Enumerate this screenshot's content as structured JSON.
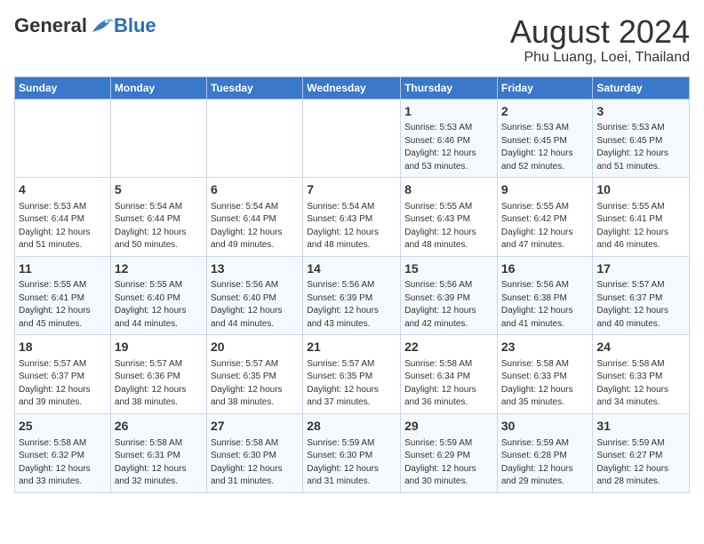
{
  "header": {
    "logo_general": "General",
    "logo_blue": "Blue",
    "title": "August 2024",
    "subtitle": "Phu Luang, Loei, Thailand"
  },
  "days_of_week": [
    "Sunday",
    "Monday",
    "Tuesday",
    "Wednesday",
    "Thursday",
    "Friday",
    "Saturday"
  ],
  "weeks": [
    [
      {
        "day": "",
        "info": ""
      },
      {
        "day": "",
        "info": ""
      },
      {
        "day": "",
        "info": ""
      },
      {
        "day": "",
        "info": ""
      },
      {
        "day": "1",
        "info": "Sunrise: 5:53 AM\nSunset: 6:46 PM\nDaylight: 12 hours\nand 53 minutes."
      },
      {
        "day": "2",
        "info": "Sunrise: 5:53 AM\nSunset: 6:45 PM\nDaylight: 12 hours\nand 52 minutes."
      },
      {
        "day": "3",
        "info": "Sunrise: 5:53 AM\nSunset: 6:45 PM\nDaylight: 12 hours\nand 51 minutes."
      }
    ],
    [
      {
        "day": "4",
        "info": "Sunrise: 5:53 AM\nSunset: 6:44 PM\nDaylight: 12 hours\nand 51 minutes."
      },
      {
        "day": "5",
        "info": "Sunrise: 5:54 AM\nSunset: 6:44 PM\nDaylight: 12 hours\nand 50 minutes."
      },
      {
        "day": "6",
        "info": "Sunrise: 5:54 AM\nSunset: 6:44 PM\nDaylight: 12 hours\nand 49 minutes."
      },
      {
        "day": "7",
        "info": "Sunrise: 5:54 AM\nSunset: 6:43 PM\nDaylight: 12 hours\nand 48 minutes."
      },
      {
        "day": "8",
        "info": "Sunrise: 5:55 AM\nSunset: 6:43 PM\nDaylight: 12 hours\nand 48 minutes."
      },
      {
        "day": "9",
        "info": "Sunrise: 5:55 AM\nSunset: 6:42 PM\nDaylight: 12 hours\nand 47 minutes."
      },
      {
        "day": "10",
        "info": "Sunrise: 5:55 AM\nSunset: 6:41 PM\nDaylight: 12 hours\nand 46 minutes."
      }
    ],
    [
      {
        "day": "11",
        "info": "Sunrise: 5:55 AM\nSunset: 6:41 PM\nDaylight: 12 hours\nand 45 minutes."
      },
      {
        "day": "12",
        "info": "Sunrise: 5:55 AM\nSunset: 6:40 PM\nDaylight: 12 hours\nand 44 minutes."
      },
      {
        "day": "13",
        "info": "Sunrise: 5:56 AM\nSunset: 6:40 PM\nDaylight: 12 hours\nand 44 minutes."
      },
      {
        "day": "14",
        "info": "Sunrise: 5:56 AM\nSunset: 6:39 PM\nDaylight: 12 hours\nand 43 minutes."
      },
      {
        "day": "15",
        "info": "Sunrise: 5:56 AM\nSunset: 6:39 PM\nDaylight: 12 hours\nand 42 minutes."
      },
      {
        "day": "16",
        "info": "Sunrise: 5:56 AM\nSunset: 6:38 PM\nDaylight: 12 hours\nand 41 minutes."
      },
      {
        "day": "17",
        "info": "Sunrise: 5:57 AM\nSunset: 6:37 PM\nDaylight: 12 hours\nand 40 minutes."
      }
    ],
    [
      {
        "day": "18",
        "info": "Sunrise: 5:57 AM\nSunset: 6:37 PM\nDaylight: 12 hours\nand 39 minutes."
      },
      {
        "day": "19",
        "info": "Sunrise: 5:57 AM\nSunset: 6:36 PM\nDaylight: 12 hours\nand 38 minutes."
      },
      {
        "day": "20",
        "info": "Sunrise: 5:57 AM\nSunset: 6:35 PM\nDaylight: 12 hours\nand 38 minutes."
      },
      {
        "day": "21",
        "info": "Sunrise: 5:57 AM\nSunset: 6:35 PM\nDaylight: 12 hours\nand 37 minutes."
      },
      {
        "day": "22",
        "info": "Sunrise: 5:58 AM\nSunset: 6:34 PM\nDaylight: 12 hours\nand 36 minutes."
      },
      {
        "day": "23",
        "info": "Sunrise: 5:58 AM\nSunset: 6:33 PM\nDaylight: 12 hours\nand 35 minutes."
      },
      {
        "day": "24",
        "info": "Sunrise: 5:58 AM\nSunset: 6:33 PM\nDaylight: 12 hours\nand 34 minutes."
      }
    ],
    [
      {
        "day": "25",
        "info": "Sunrise: 5:58 AM\nSunset: 6:32 PM\nDaylight: 12 hours\nand 33 minutes."
      },
      {
        "day": "26",
        "info": "Sunrise: 5:58 AM\nSunset: 6:31 PM\nDaylight: 12 hours\nand 32 minutes."
      },
      {
        "day": "27",
        "info": "Sunrise: 5:58 AM\nSunset: 6:30 PM\nDaylight: 12 hours\nand 31 minutes."
      },
      {
        "day": "28",
        "info": "Sunrise: 5:59 AM\nSunset: 6:30 PM\nDaylight: 12 hours\nand 31 minutes."
      },
      {
        "day": "29",
        "info": "Sunrise: 5:59 AM\nSunset: 6:29 PM\nDaylight: 12 hours\nand 30 minutes."
      },
      {
        "day": "30",
        "info": "Sunrise: 5:59 AM\nSunset: 6:28 PM\nDaylight: 12 hours\nand 29 minutes."
      },
      {
        "day": "31",
        "info": "Sunrise: 5:59 AM\nSunset: 6:27 PM\nDaylight: 12 hours\nand 28 minutes."
      }
    ]
  ]
}
